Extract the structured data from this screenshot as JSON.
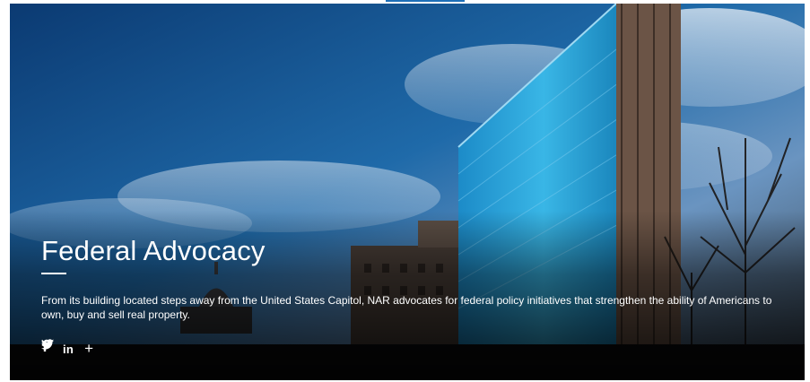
{
  "hero": {
    "title": "Federal Advocacy",
    "description": "From its building located steps away from the United States Capitol, NAR advocates for federal policy initiatives that strengthen the ability of Americans to own, buy and sell real property.",
    "background_description": "photo",
    "share": {
      "linkedin_label": "in",
      "more_label": "+",
      "icons": [
        "facebook-icon",
        "twitter-icon",
        "linkedin-icon",
        "plus-icon"
      ]
    }
  },
  "colors": {
    "accent": "#1e6fb8",
    "text_on_hero": "#ffffff"
  }
}
